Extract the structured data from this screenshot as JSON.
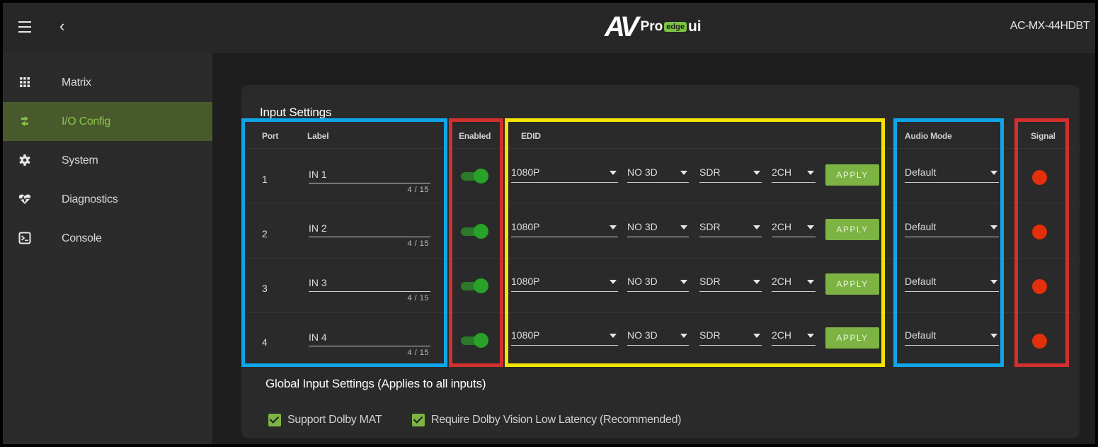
{
  "header": {
    "model": "AC-MX-44HDBT",
    "logo": {
      "av": "AV",
      "pro": "Pro",
      "edge": "edge",
      "ui": "ui"
    }
  },
  "sidebar": {
    "items": [
      {
        "label": "Matrix",
        "icon": "grid-icon",
        "active": false
      },
      {
        "label": "I/O Config",
        "icon": "swap-arrows-icon",
        "active": true
      },
      {
        "label": "System",
        "icon": "gear-icon",
        "active": false
      },
      {
        "label": "Diagnostics",
        "icon": "heartbeat-icon",
        "active": false
      },
      {
        "label": "Console",
        "icon": "terminal-icon",
        "active": false
      }
    ]
  },
  "input_settings": {
    "title": "Input Settings",
    "columns": {
      "port": "Port",
      "label": "Label",
      "enabled": "Enabled",
      "edid": "EDID",
      "audio_mode": "Audio Mode",
      "signal": "Signal"
    },
    "apply_label": "APPLY",
    "rows": [
      {
        "port": "1",
        "label": "IN 1",
        "counter": "4 / 15",
        "enabled": true,
        "resolution": "1080P",
        "mode3d": "NO 3D",
        "hdr": "SDR",
        "channels": "2CH",
        "audio_mode": "Default",
        "signal": "none"
      },
      {
        "port": "2",
        "label": "IN 2",
        "counter": "4 / 15",
        "enabled": true,
        "resolution": "1080P",
        "mode3d": "NO 3D",
        "hdr": "SDR",
        "channels": "2CH",
        "audio_mode": "Default",
        "signal": "none"
      },
      {
        "port": "3",
        "label": "IN 3",
        "counter": "4 / 15",
        "enabled": true,
        "resolution": "1080P",
        "mode3d": "NO 3D",
        "hdr": "SDR",
        "channels": "2CH",
        "audio_mode": "Default",
        "signal": "none"
      },
      {
        "port": "4",
        "label": "IN 4",
        "counter": "4 / 15",
        "enabled": true,
        "resolution": "1080P",
        "mode3d": "NO 3D",
        "hdr": "SDR",
        "channels": "2CH",
        "audio_mode": "Default",
        "signal": "none"
      }
    ]
  },
  "global_settings": {
    "title": "Global Input Settings (Applies to all inputs)",
    "options": [
      {
        "label": "Support Dolby MAT",
        "checked": true
      },
      {
        "label": "Require Dolby Vision Low Latency (Recommended)",
        "checked": true
      }
    ]
  },
  "colors": {
    "accent_green": "#7cb342",
    "active_nav_bg": "#485a2c",
    "signal_off": "#e32f0c",
    "highlight_blue": "#0ea5e9",
    "highlight_red": "#d32f2f",
    "highlight_yellow": "#f5e400"
  }
}
